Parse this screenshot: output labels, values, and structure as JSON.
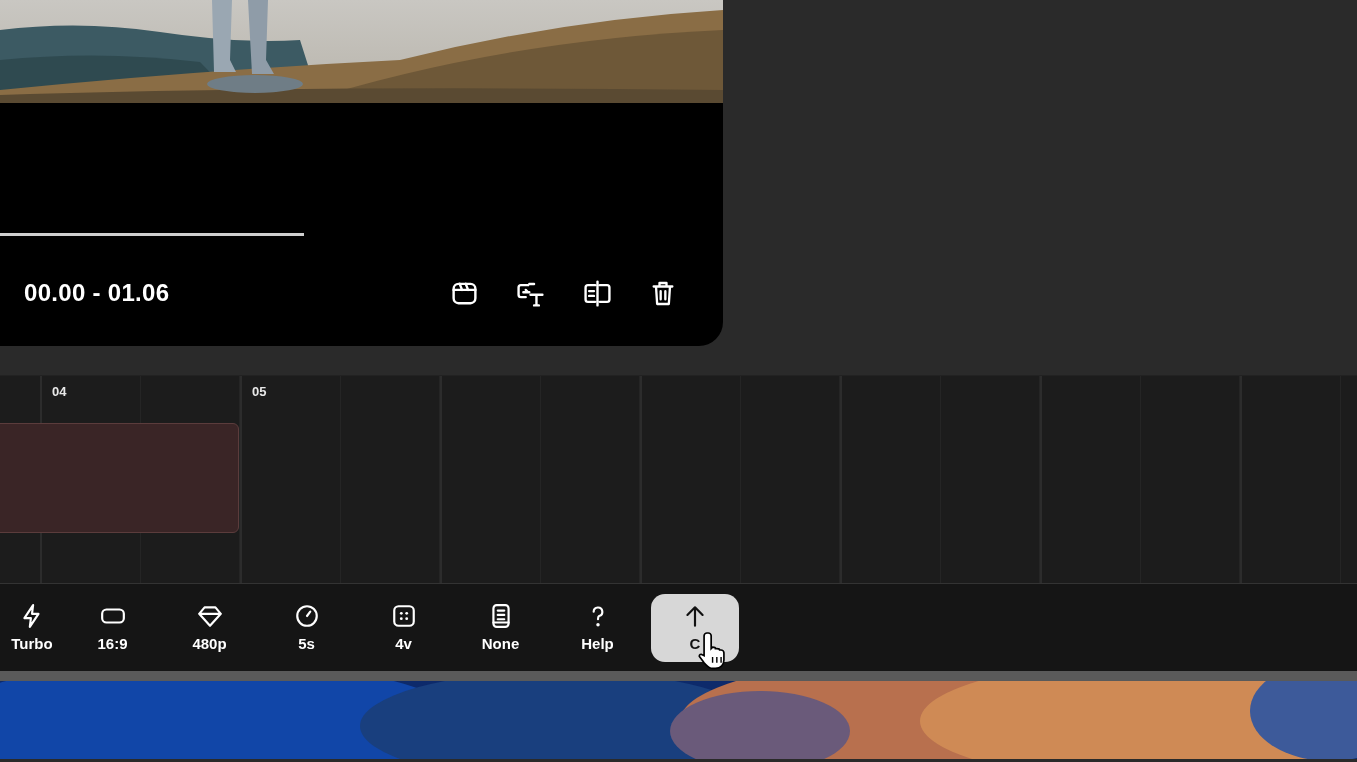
{
  "preview": {
    "kind": "picture",
    "progress": {
      "level": 0.42
    },
    "time_range": "00.00 - 01.06"
  },
  "timeline": {
    "ruler": [
      {
        "label": "04"
      },
      {
        "label": "05"
      }
    ]
  },
  "toolbar": {
    "items": [
      {
        "label": "Turbo",
        "selected": false
      },
      {
        "label": "16:9",
        "selected": false
      },
      {
        "label": "480p",
        "selected": false
      },
      {
        "label": "5s",
        "selected": false
      },
      {
        "label": "4v",
        "selected": false
      },
      {
        "label": "None",
        "selected": false
      },
      {
        "label": "Help",
        "selected": false
      },
      {
        "label": "C",
        "selected": true
      }
    ]
  }
}
